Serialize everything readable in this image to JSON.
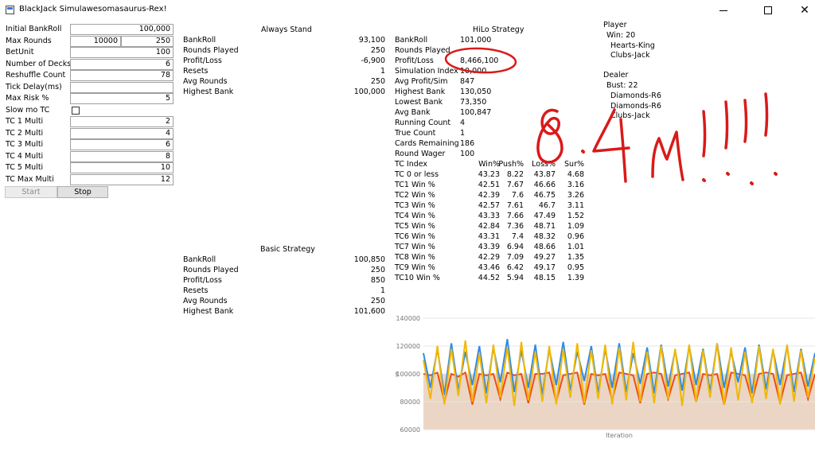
{
  "window": {
    "title": "BlackJack Simulawesomasaurus-Rex!",
    "controls": [
      "minimize-icon",
      "maximize-icon",
      "close-icon"
    ]
  },
  "settings": {
    "initial_bankroll": {
      "label": "Initial BankRoll",
      "value": "100,000"
    },
    "max_rounds": {
      "label": "Max Rounds",
      "value1": "10000",
      "value2": "250"
    },
    "bet_unit": {
      "label": "BetUnit",
      "value": "100"
    },
    "num_decks": {
      "label": "Number of Decks",
      "value": "6"
    },
    "reshuffle": {
      "label": "Reshuffle Count",
      "value": "78"
    },
    "tick_delay": {
      "label": "Tick Delay(ms)",
      "value": ""
    },
    "max_risk": {
      "label": "Max Risk %",
      "value": "5"
    },
    "slow_mo": {
      "label": "Slow mo TC",
      "checked": false
    },
    "tc1": {
      "label": "TC 1 Multi",
      "value": "2"
    },
    "tc2": {
      "label": "TC 2 Multi",
      "value": "4"
    },
    "tc3": {
      "label": "TC 3 Multi",
      "value": "6"
    },
    "tc4": {
      "label": "TC 4 Multi",
      "value": "8"
    },
    "tc5": {
      "label": "TC 5 Multi",
      "value": "10"
    },
    "tcmax": {
      "label": "TC Max Multi",
      "value": "12"
    },
    "start_label": "Start",
    "stop_label": "Stop"
  },
  "always_stand": {
    "title": "Always Stand",
    "rows": [
      {
        "label": "BankRoll",
        "value": "93,100"
      },
      {
        "label": "Rounds Played",
        "value": "250"
      },
      {
        "label": "Profit/Loss",
        "value": "-6,900"
      },
      {
        "label": "Resets",
        "value": "1"
      },
      {
        "label": "Avg Rounds",
        "value": "250"
      },
      {
        "label": "Highest Bank",
        "value": "100,000"
      }
    ]
  },
  "basic_strategy": {
    "title": "Basic Strategy",
    "rows": [
      {
        "label": "BankRoll",
        "value": "100,850"
      },
      {
        "label": "Rounds Played",
        "value": "250"
      },
      {
        "label": "Profit/Loss",
        "value": "850"
      },
      {
        "label": "Resets",
        "value": "1"
      },
      {
        "label": "Avg Rounds",
        "value": "250"
      },
      {
        "label": "Highest Bank",
        "value": "101,600"
      }
    ]
  },
  "hilo": {
    "title": "HiLo Strategy",
    "rows": [
      {
        "label": "BankRoll",
        "value": "101,000"
      },
      {
        "label": "Rounds Played",
        "value": ""
      },
      {
        "label": "Profit/Loss",
        "value": "8,466,100"
      },
      {
        "label": "Simulation Index",
        "value": "10,000"
      },
      {
        "label": "Avg Profit/Sim",
        "value": "847"
      },
      {
        "label": "Highest Bank",
        "value": "130,050"
      },
      {
        "label": "Lowest Bank",
        "value": "73,350"
      },
      {
        "label": "Avg Bank",
        "value": "100,847"
      },
      {
        "label": "Running Count",
        "value": "4"
      },
      {
        "label": "True Count",
        "value": "1"
      },
      {
        "label": "Cards Remaining",
        "value": "186"
      },
      {
        "label": "Round Wager",
        "value": "100"
      }
    ],
    "tc_table": {
      "headers": [
        "TC Index",
        "Win%",
        "Push%",
        "Loss%",
        "Sur%"
      ],
      "rows": [
        [
          "TC 0 or less",
          "43.23",
          "8.22",
          "43.87",
          "4.68"
        ],
        [
          "TC1 Win %",
          "42.51",
          "7.67",
          "46.66",
          "3.16"
        ],
        [
          "TC2 Win %",
          "42.39",
          "7.6",
          "46.75",
          "3.26"
        ],
        [
          "TC3 Win %",
          "42.57",
          "7.61",
          "46.7",
          "3.11"
        ],
        [
          "TC4 Win %",
          "43.33",
          "7.66",
          "47.49",
          "1.52"
        ],
        [
          "TC5 Win %",
          "42.84",
          "7.36",
          "48.71",
          "1.09"
        ],
        [
          "TC6 Win %",
          "43.31",
          "7.4",
          "48.32",
          "0.96"
        ],
        [
          "TC7 Win %",
          "43.39",
          "6.94",
          "48.66",
          "1.01"
        ],
        [
          "TC8 Win %",
          "42.29",
          "7.09",
          "49.27",
          "1.35"
        ],
        [
          "TC9 Win %",
          "43.46",
          "6.42",
          "49.17",
          "0.95"
        ],
        [
          "TC10 Win %",
          "44.52",
          "5.94",
          "48.15",
          "1.39"
        ]
      ]
    }
  },
  "player": {
    "title": "Player",
    "win_text": "Win: 20",
    "cards": [
      "Hearts-King",
      "Clubs-Jack"
    ]
  },
  "dealer": {
    "title": "Dealer",
    "bust_text": "Bust: 22",
    "cards": [
      "Diamonds-R6",
      "Diamonds-R6",
      "Clubs-Jack"
    ]
  },
  "annotation": {
    "text": "8.4M!!!",
    "color": "#d91a1a"
  },
  "chart_data": {
    "type": "line",
    "xlabel": "Iteration",
    "ylabel": "$",
    "ylim": [
      60000,
      140000
    ],
    "yticks": [
      "140000",
      "120000",
      "100000",
      "80000",
      "60000"
    ],
    "grid": true,
    "colors": {
      "blue": "#2e8be8",
      "yellow": "#f2b705",
      "red": "#f04a1a",
      "fill": "#e9d2bf"
    },
    "series": [
      {
        "color": "blue",
        "values": [
          115000,
          90000,
          118000,
          85000,
          122000,
          88000,
          116000,
          92000,
          120000,
          86000,
          119000,
          94000,
          125000,
          87000,
          117000,
          90000,
          121000,
          85000,
          118000,
          92000,
          123000,
          88000,
          116000,
          95000,
          120000,
          86000,
          118000,
          90000,
          122000,
          87000,
          115000,
          93000,
          119000,
          86000,
          121000,
          91000,
          117000,
          88000,
          120000,
          92000,
          118000,
          87000,
          122000,
          90000,
          116000,
          94000,
          119000,
          86000,
          121000,
          89000,
          117000,
          92000,
          120000,
          87000,
          118000,
          91000,
          115000
        ]
      },
      {
        "color": "yellow",
        "values": [
          110000,
          82000,
          120000,
          78000,
          118000,
          84000,
          124000,
          80000,
          115000,
          79000,
          121000,
          83000,
          119000,
          77000,
          123000,
          81000,
          116000,
          80000,
          120000,
          78000,
          118000,
          83000,
          122000,
          79000,
          117000,
          82000,
          121000,
          78000,
          119000,
          81000,
          123000,
          80000,
          116000,
          79000,
          120000,
          82000,
          118000,
          77000,
          121000,
          80000,
          117000,
          83000,
          122000,
          78000,
          119000,
          81000,
          116000,
          79000,
          120000,
          82000,
          118000,
          78000,
          121000,
          80000,
          117000,
          83000,
          112000
        ]
      },
      {
        "color": "red",
        "values": [
          100000,
          99000,
          101000,
          80000,
          100000,
          98000,
          101000,
          78000,
          100000,
          99000,
          100000,
          82000,
          101000,
          99000,
          100000,
          79000,
          100000,
          100000,
          101000,
          80000,
          99000,
          100000,
          101000,
          78000,
          100000,
          99000,
          100000,
          81000,
          101000,
          100000,
          99000,
          79000,
          100000,
          101000,
          100000,
          82000,
          99000,
          100000,
          101000,
          80000,
          100000,
          99000,
          100000,
          78000,
          101000,
          100000,
          99000,
          81000,
          100000,
          101000,
          100000,
          79000,
          99000,
          100000,
          101000,
          82000,
          100000
        ]
      }
    ]
  }
}
